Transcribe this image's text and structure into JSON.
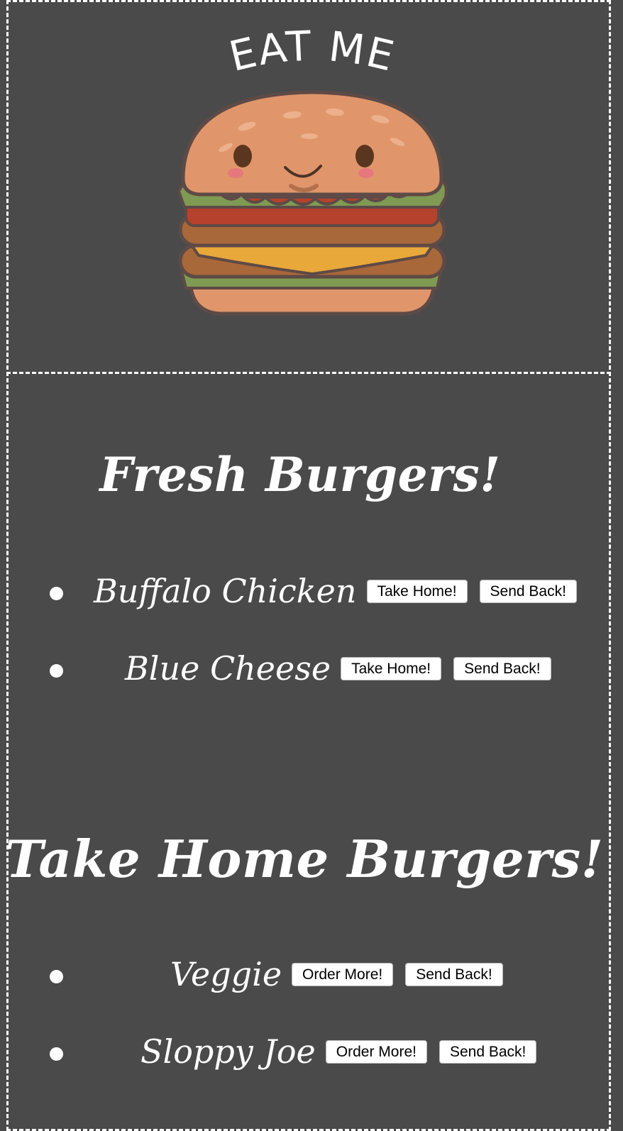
{
  "logo": {
    "text": "EAT ME"
  },
  "fresh": {
    "title": "Fresh Burgers!",
    "items": [
      {
        "name": "Buffalo Chicken",
        "primary": "Take Home!",
        "secondary": "Send Back!"
      },
      {
        "name": "Blue Cheese",
        "primary": "Take Home!",
        "secondary": "Send Back!"
      }
    ]
  },
  "home": {
    "title": "Take Home Burgers!",
    "items": [
      {
        "name": "Veggie",
        "primary": "Order More!",
        "secondary": "Send Back!"
      },
      {
        "name": "Sloppy Joe",
        "primary": "Order More!",
        "secondary": "Send Back!"
      }
    ]
  },
  "colors": {
    "background": "#4a4a4a",
    "text": "#ffffff",
    "bun": "#e0966a",
    "lettuce": "#7f9a53",
    "tomato": "#b6412d",
    "patty": "#a8683a",
    "cheese": "#e8a83a"
  }
}
